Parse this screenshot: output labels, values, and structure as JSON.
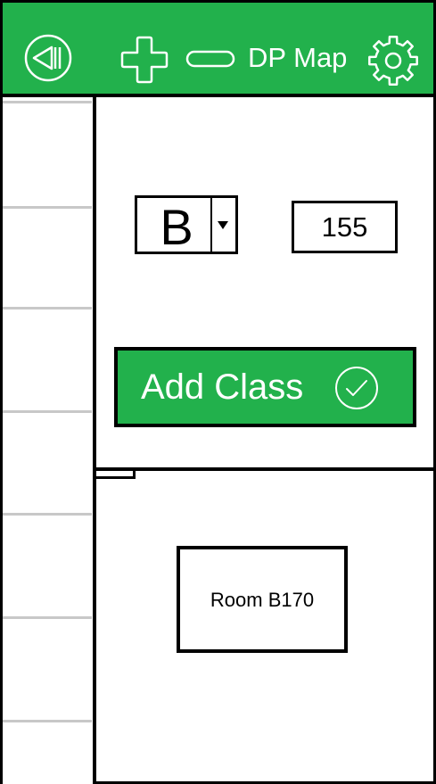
{
  "header": {
    "title": "DP Map",
    "background_color": "#22b14c",
    "icons": {
      "back": "back-triangle-icon",
      "zoom_in": "plus-icon",
      "zoom_out": "minus-icon",
      "settings": "gear-icon"
    }
  },
  "sidebar": {
    "slot_count": 7
  },
  "controls": {
    "building_select": {
      "value": "B",
      "arrow_icon": "dropdown-arrow-icon"
    },
    "room_number_input": {
      "value": "155"
    },
    "add_class_button": {
      "label": "Add Class",
      "icon": "check-circle-icon",
      "color": "#22b14c"
    }
  },
  "map": {
    "room": {
      "label": "Room B170"
    }
  }
}
